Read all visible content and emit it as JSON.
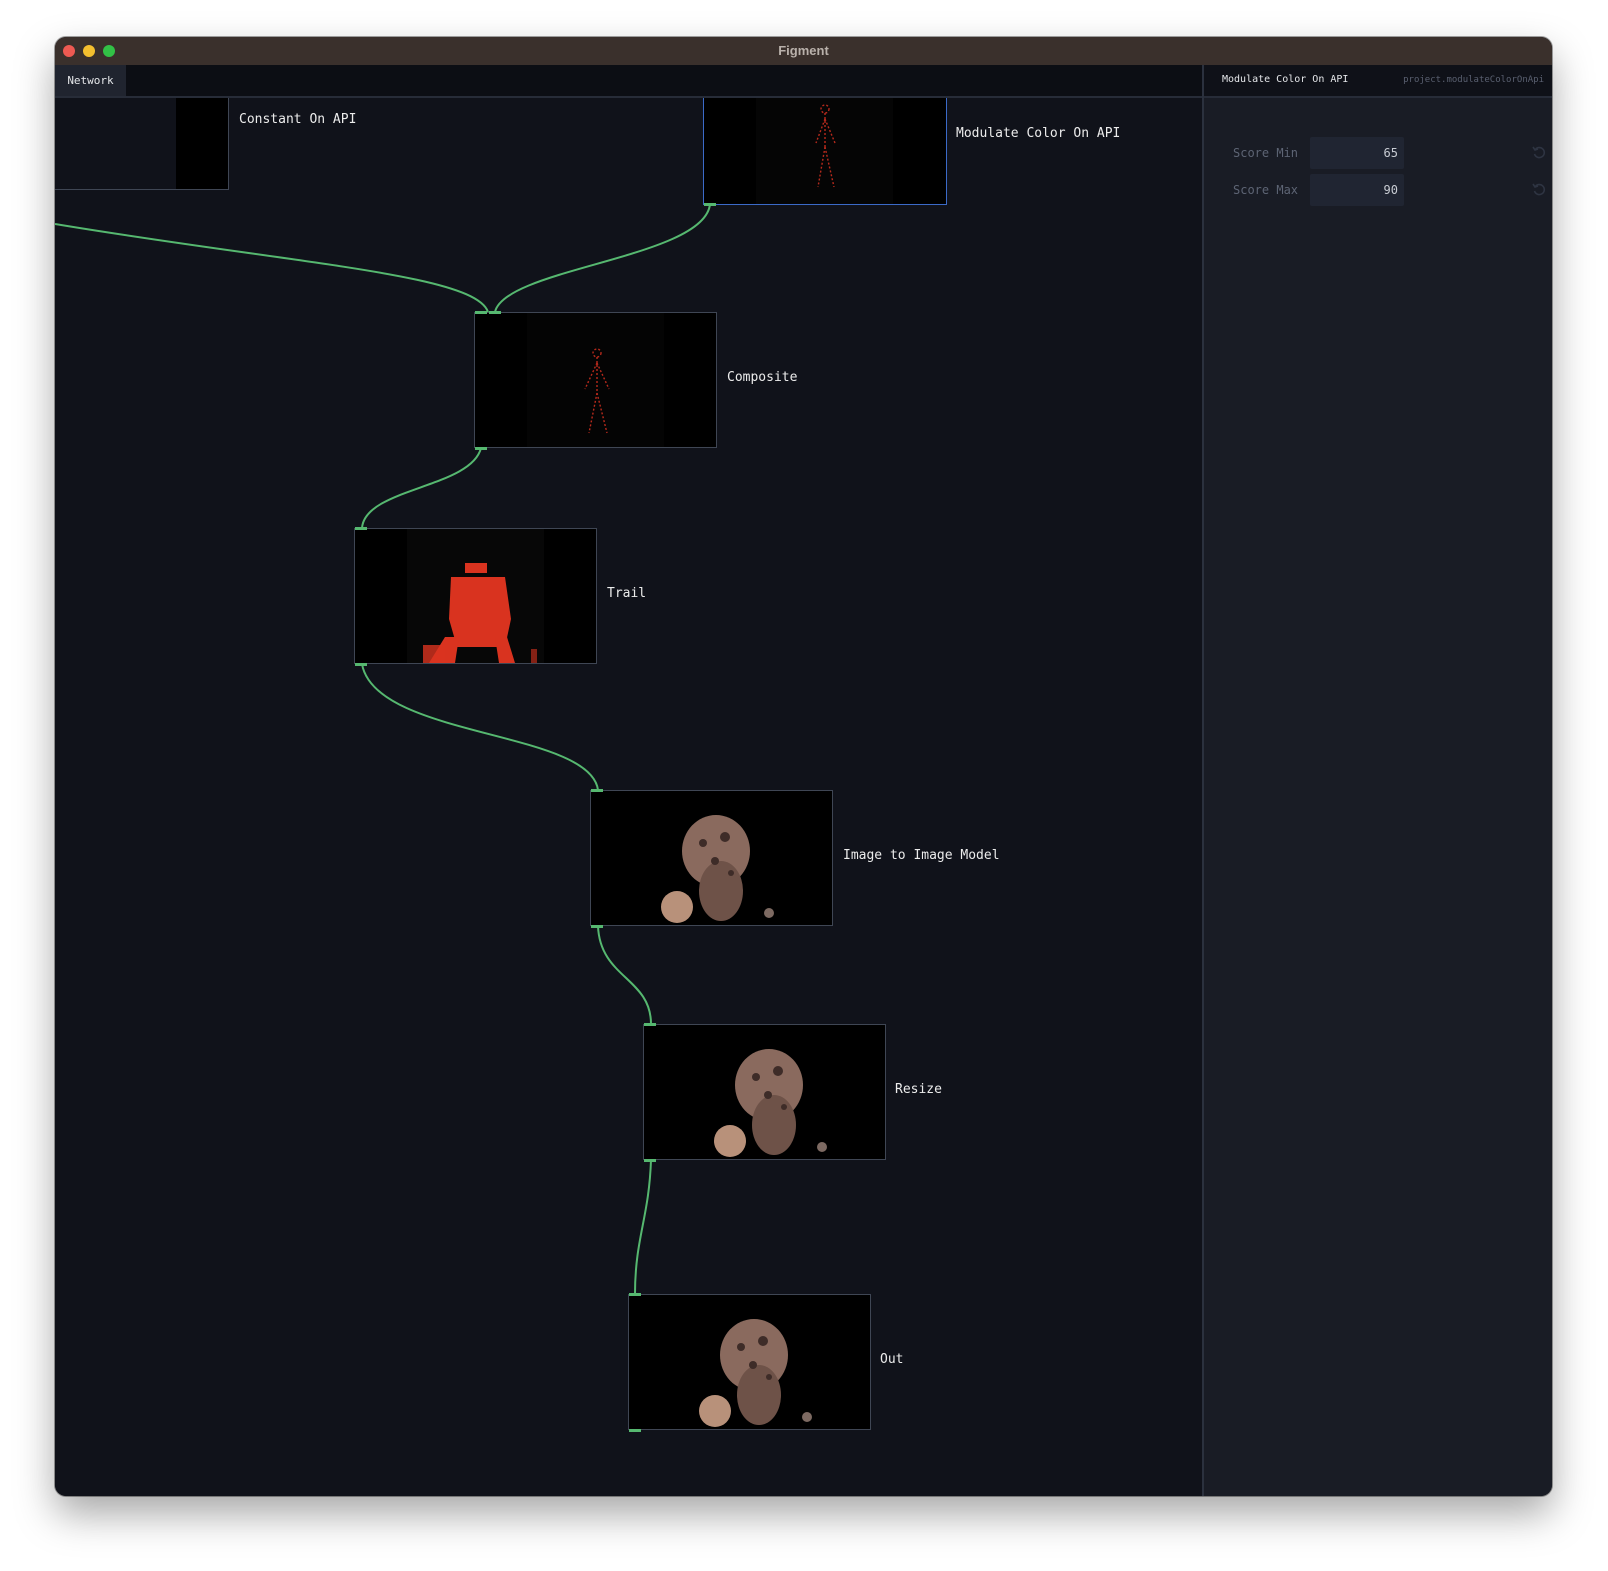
{
  "window": {
    "title": "Figment"
  },
  "network": {
    "tab_label": "Network",
    "wire_color": "#56b870",
    "nodes": [
      {
        "id": "constant",
        "label": "Constant On API"
      },
      {
        "id": "modulate",
        "label": "Modulate Color On API",
        "selected": true
      },
      {
        "id": "composite",
        "label": "Composite"
      },
      {
        "id": "trail",
        "label": "Trail"
      },
      {
        "id": "img2img",
        "label": "Image to Image Model"
      },
      {
        "id": "resize",
        "label": "Resize"
      },
      {
        "id": "out",
        "label": "Out"
      }
    ]
  },
  "inspector": {
    "title": "Modulate Color On API",
    "path": "project.modulateColorOnApi",
    "params": [
      {
        "label": "Score Min",
        "value": "65",
        "reset_icon": "reset-icon"
      },
      {
        "label": "Score Max",
        "value": "90",
        "reset_icon": "reset-icon"
      }
    ]
  },
  "colors": {
    "accent_selected": "#3b6ac8",
    "wire": "#56b870",
    "thumbnail_red": "#d9331f"
  }
}
